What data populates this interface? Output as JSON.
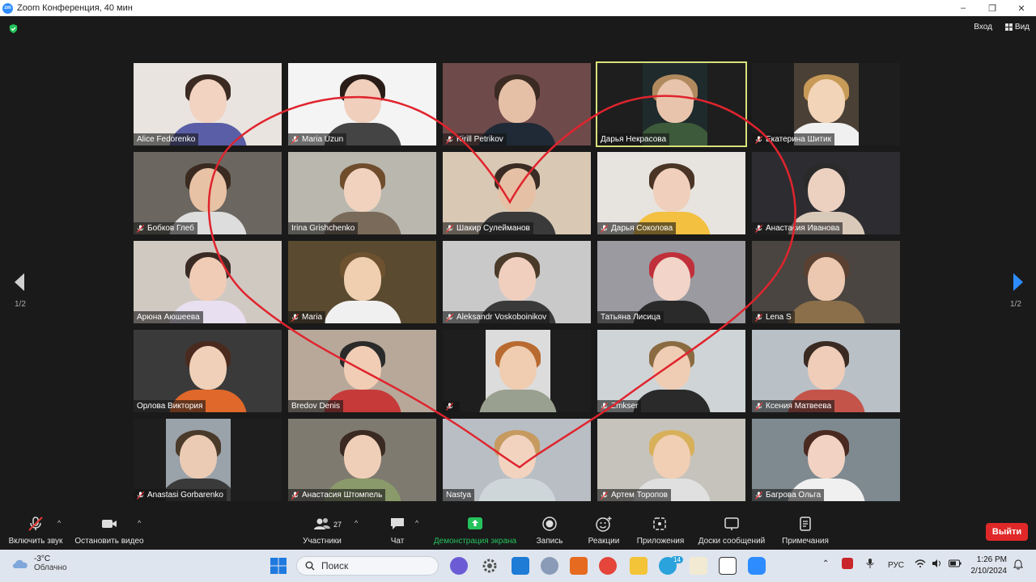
{
  "window": {
    "title": "Zoom Конференция, 40 мин",
    "minimize": "–",
    "maximize": "❐",
    "close": "✕"
  },
  "topbar": {
    "sign_in": "Вход",
    "view": "Вид"
  },
  "participants": [
    {
      "name": "Alice Fedorenko",
      "muted": false
    },
    {
      "name": "Maria Uzun",
      "muted": true
    },
    {
      "name": "Kirill Petrikov",
      "muted": true
    },
    {
      "name": "Дарья Некрасова",
      "muted": false
    },
    {
      "name": "Екатерина Шитик",
      "muted": true
    },
    {
      "name": "Бобков Глеб",
      "muted": true
    },
    {
      "name": "Irina Grishchenko",
      "muted": false
    },
    {
      "name": "Шакир Сулейманов",
      "muted": true
    },
    {
      "name": "Дарья Соколова",
      "muted": true
    },
    {
      "name": "Анастасия Иванова",
      "muted": true
    },
    {
      "name": "Арюна Аюшеева",
      "muted": false
    },
    {
      "name": "Maria",
      "muted": true
    },
    {
      "name": "Aleksandr Voskoboinikov",
      "muted": true
    },
    {
      "name": "Татьяна Лисица",
      "muted": false
    },
    {
      "name": "Lena S",
      "muted": true
    },
    {
      "name": "Орлова Виктория",
      "muted": false
    },
    {
      "name": "Bredov Denis",
      "muted": false
    },
    {
      "name": "",
      "muted": true
    },
    {
      "name": "Zmkser",
      "muted": true
    },
    {
      "name": "Ксения Матвеева",
      "muted": true
    },
    {
      "name": "Anastasi Gorbarenko",
      "muted": true
    },
    {
      "name": "Анастасия Штомпель",
      "muted": true
    },
    {
      "name": "Nastya",
      "muted": false
    },
    {
      "name": "Артем Торопов",
      "muted": true
    },
    {
      "name": "Багрова Ольга",
      "muted": true
    }
  ],
  "pagination": {
    "left": "1/2",
    "right": "1/2"
  },
  "toolbar": {
    "unmute": "Включить звук",
    "stop_video": "Остановить видео",
    "participants": "Участники",
    "participants_count": "27",
    "chat": "Чат",
    "share_screen": "Демонстрация экрана",
    "record": "Запись",
    "reactions": "Реакции",
    "apps": "Приложения",
    "whiteboards": "Доски сообщений",
    "notes": "Примечания",
    "leave": "Выйти"
  },
  "taskbar": {
    "temperature": "-3°C",
    "weather": "Облачно",
    "search_placeholder": "Поиск",
    "language": "РУС",
    "time": "1:26 PM",
    "date": "2/10/2024",
    "telegram_badge": "14"
  },
  "colors": {
    "accent_blue": "#2d8cff",
    "share_green": "#25c25c",
    "leave_red": "#e02828",
    "active_speaker": "#d7e07a",
    "heart_red": "#e0242e"
  }
}
